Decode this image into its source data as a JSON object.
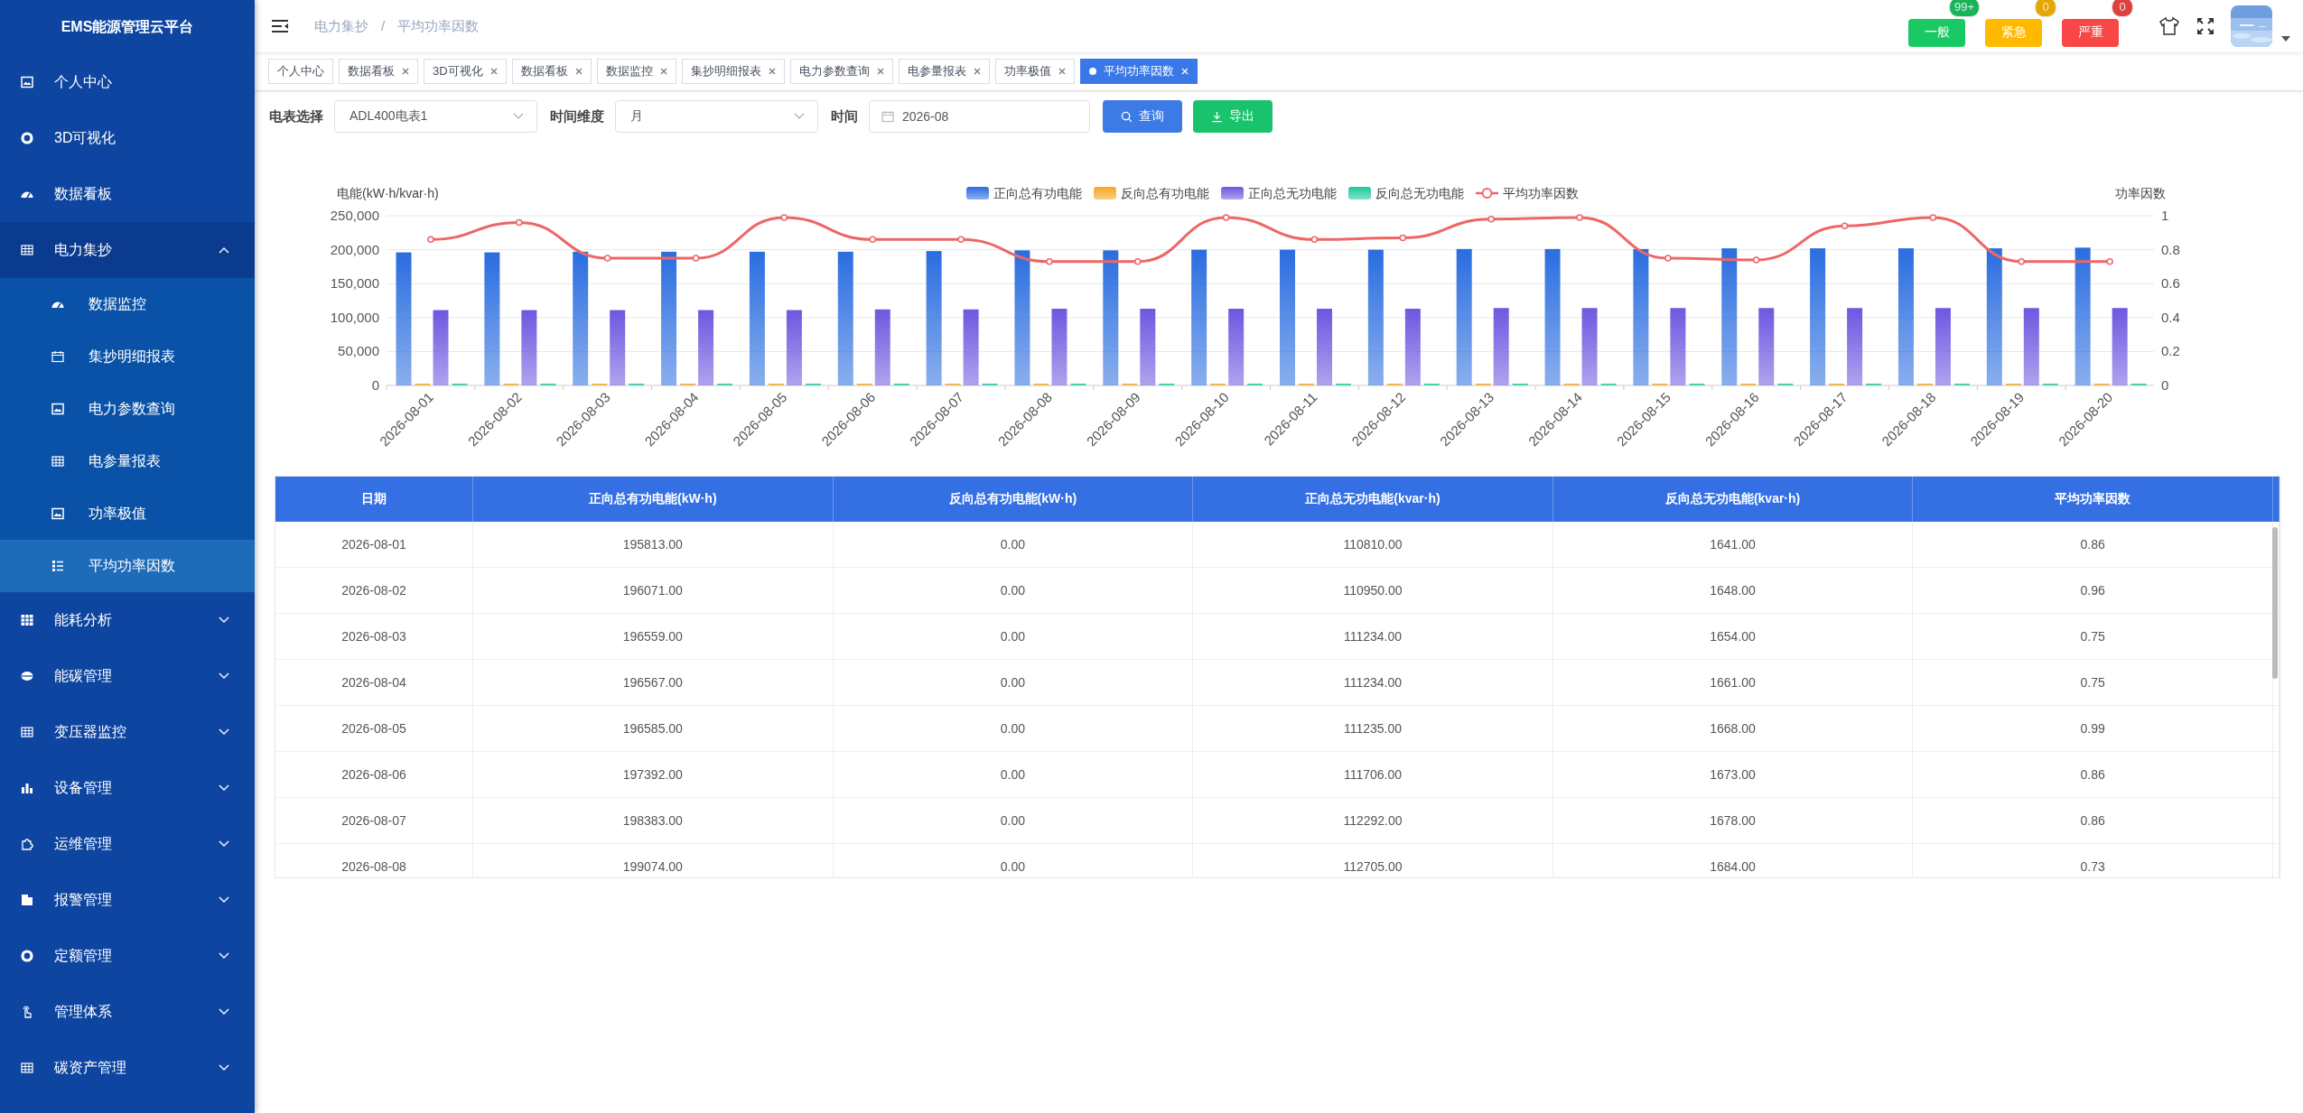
{
  "sidebar": {
    "title": "EMS能源管理云平台",
    "items": [
      {
        "label": "个人中心",
        "selected": false
      },
      {
        "label": "3D可视化",
        "selected": false
      },
      {
        "label": "数据看板",
        "selected": false
      },
      {
        "label": "电力集抄",
        "selected": false,
        "expanded": true,
        "children": [
          {
            "label": "数据监控",
            "selected": false
          },
          {
            "label": "集抄明细报表",
            "selected": false
          },
          {
            "label": "电力参数查询",
            "selected": false
          },
          {
            "label": "电参量报表",
            "selected": false
          },
          {
            "label": "功率极值",
            "selected": false
          },
          {
            "label": "平均功率因数",
            "selected": true
          }
        ]
      },
      {
        "label": "能耗分析",
        "selected": false,
        "expanded": false
      },
      {
        "label": "能碳管理",
        "selected": false,
        "expanded": false
      },
      {
        "label": "变压器监控",
        "selected": false,
        "expanded": false
      },
      {
        "label": "设备管理",
        "selected": false,
        "expanded": false
      },
      {
        "label": "运维管理",
        "selected": false,
        "expanded": false
      },
      {
        "label": "报警管理",
        "selected": false,
        "expanded": false
      },
      {
        "label": "定额管理",
        "selected": false,
        "expanded": false
      },
      {
        "label": "管理体系",
        "selected": false,
        "expanded": false
      },
      {
        "label": "碳资产管理",
        "selected": false,
        "expanded": false
      }
    ]
  },
  "header": {
    "breadcrumb": {
      "items": [
        "电力集抄",
        "平均功率因数"
      ],
      "separator": "/"
    },
    "alarms": [
      {
        "label": "一般",
        "count": "99+",
        "color": "#18c964"
      },
      {
        "label": "紧急",
        "count": "0",
        "color": "#ffba00"
      },
      {
        "label": "严重",
        "count": "0",
        "color": "#f94646"
      }
    ]
  },
  "tabs": [
    {
      "label": "个人中心",
      "selected": false,
      "closable": false
    },
    {
      "label": "数据看板",
      "selected": false,
      "closable": true
    },
    {
      "label": "3D可视化",
      "selected": false,
      "closable": true
    },
    {
      "label": "数据看板",
      "selected": false,
      "closable": true
    },
    {
      "label": "数据监控",
      "selected": false,
      "closable": true
    },
    {
      "label": "集抄明细报表",
      "selected": false,
      "closable": true
    },
    {
      "label": "电力参数查询",
      "selected": false,
      "closable": true
    },
    {
      "label": "电参量报表",
      "selected": false,
      "closable": true
    },
    {
      "label": "功率极值",
      "selected": false,
      "closable": true
    },
    {
      "label": "平均功率因数",
      "selected": true,
      "closable": true
    }
  ],
  "filters": {
    "fields": [
      {
        "label": "电表选择",
        "value": "ADL400电表1",
        "kind": "select"
      },
      {
        "label": "时间维度",
        "value": "月",
        "kind": "select"
      },
      {
        "label": "时间",
        "value": "2026-08",
        "kind": "date"
      }
    ],
    "buttons": [
      {
        "label": "查询",
        "kind": "search"
      },
      {
        "label": "导出",
        "kind": "export"
      }
    ]
  },
  "chart": {
    "chart_data": {
      "type": "bar",
      "ylabel": "电能(kW·h/kvar·h)",
      "y2label": "功率因数",
      "categories": [
        "2026-08-01",
        "2026-08-02",
        "2026-08-03",
        "2026-08-04",
        "2026-08-05",
        "2026-08-06",
        "2026-08-07",
        "2026-08-08",
        "2026-08-09",
        "2026-08-10",
        "2026-08-11",
        "2026-08-12",
        "2026-08-13",
        "2026-08-14",
        "2026-08-15",
        "2026-08-16",
        "2026-08-17",
        "2026-08-18",
        "2026-08-19",
        "2026-08-20"
      ],
      "series": [
        {
          "name": "正向总有功电能",
          "color": "#2a6de0",
          "values": [
            196000,
            196000,
            197000,
            197000,
            197000,
            197000,
            198000,
            199000,
            199000,
            200000,
            200000,
            200000,
            201000,
            201000,
            201000,
            202000,
            202000,
            202000,
            202000,
            203000
          ]
        },
        {
          "name": "反向总有功电能",
          "color": "#f5a623",
          "values": [
            0,
            0,
            0,
            0,
            0,
            0,
            0,
            0,
            0,
            0,
            0,
            0,
            0,
            0,
            0,
            0,
            0,
            0,
            0,
            0
          ]
        },
        {
          "name": "正向总无功电能",
          "color": "#6c58e0",
          "values": [
            111000,
            111000,
            111000,
            111000,
            111000,
            112000,
            112000,
            113000,
            113000,
            113000,
            113000,
            113000,
            114000,
            114000,
            114000,
            114000,
            114000,
            114000,
            114000,
            114000
          ]
        },
        {
          "name": "反向总无功电能",
          "color": "#1dc99a",
          "values": [
            2000,
            2000,
            2000,
            2000,
            2000,
            2000,
            2000,
            2000,
            2000,
            2000,
            2000,
            2000,
            2000,
            2000,
            2000,
            2000,
            2000,
            2000,
            2000,
            2000
          ]
        },
        {
          "name": "平均功率因数",
          "type": "line",
          "axis": "y2",
          "marker": true,
          "color": "#ee6666",
          "values": [
            0.86,
            0.96,
            0.75,
            0.75,
            0.99,
            0.86,
            0.86,
            0.73,
            0.73,
            0.99,
            0.86,
            0.87,
            0.98,
            0.99,
            0.75,
            0.74,
            0.94,
            0.99,
            0.73,
            0.73
          ]
        }
      ],
      "grid": true,
      "legend": true,
      "ylim": [
        0,
        250000
      ],
      "yticks": [
        {
          "value": 0,
          "label": "0"
        },
        {
          "value": 50000,
          "label": "50,000"
        },
        {
          "value": 100000,
          "label": "100,000"
        },
        {
          "value": 150000,
          "label": "150,000"
        },
        {
          "value": 200000,
          "label": "200,000"
        },
        {
          "value": 250000,
          "label": "250,000"
        }
      ],
      "y2lim": [
        0,
        1
      ],
      "y2ticks": [
        {
          "value": 0,
          "label": "0"
        },
        {
          "value": 0.2,
          "label": "0.2"
        },
        {
          "value": 0.4,
          "label": "0.4"
        },
        {
          "value": 0.6,
          "label": "0.6"
        },
        {
          "value": 0.8,
          "label": "0.8"
        },
        {
          "value": 1,
          "label": "1"
        }
      ]
    }
  },
  "table": {
    "columns": [
      "日期",
      "正向总有功电能(kW·h)",
      "反向总有功电能(kW·h)",
      "正向总无功电能(kvar·h)",
      "反向总无功电能(kvar·h)",
      "平均功率因数"
    ],
    "rows": [
      [
        "2026-08-01",
        "195813.00",
        "0.00",
        "110810.00",
        "1641.00",
        "0.86"
      ],
      [
        "2026-08-02",
        "196071.00",
        "0.00",
        "110950.00",
        "1648.00",
        "0.96"
      ],
      [
        "2026-08-03",
        "196559.00",
        "0.00",
        "111234.00",
        "1654.00",
        "0.75"
      ],
      [
        "2026-08-04",
        "196567.00",
        "0.00",
        "111234.00",
        "1661.00",
        "0.75"
      ],
      [
        "2026-08-05",
        "196585.00",
        "0.00",
        "111235.00",
        "1668.00",
        "0.99"
      ],
      [
        "2026-08-06",
        "197392.00",
        "0.00",
        "111706.00",
        "1673.00",
        "0.86"
      ],
      [
        "2026-08-07",
        "198383.00",
        "0.00",
        "112292.00",
        "1678.00",
        "0.86"
      ],
      [
        "2026-08-08",
        "199074.00",
        "0.00",
        "112705.00",
        "1684.00",
        "0.73"
      ]
    ]
  }
}
